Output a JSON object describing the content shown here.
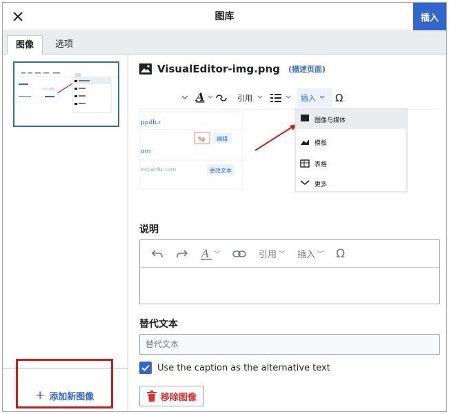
{
  "dialog": {
    "title": "图库",
    "insert_label": "插入",
    "close_icon": "close-icon"
  },
  "tabs": [
    {
      "label": "图像",
      "active": true
    },
    {
      "label": "选项",
      "active": false
    }
  ],
  "sidebar": {
    "add_label": "添加新图像"
  },
  "main": {
    "file_name": "VisualEditor-img.png",
    "desc_link": "(描述页面)",
    "caption_heading": "说明",
    "caption_toolbar": {
      "cite": "引用",
      "insert": "插入"
    },
    "alt_heading": "替代文本",
    "alt_placeholder": "替代文本",
    "checkbox_label": "Use the caption as the alternative text",
    "checkbox_checked": true,
    "remove_label": "移除图像"
  },
  "preview": {
    "toolbar_cite": "引用",
    "toolbar_insert": "插入",
    "menu_items": [
      "图像与媒体",
      "模板",
      "表格",
      "更多"
    ],
    "tag_text": "fig",
    "link_text": "编辑",
    "domain_text": "ecbaidu.com",
    "change_text": "更改文本",
    "snippet1": "ppdb.r",
    "snippet2": "om"
  },
  "colors": {
    "accent": "#3366cc",
    "danger": "#d33333",
    "highlight": "#d11b1b"
  }
}
